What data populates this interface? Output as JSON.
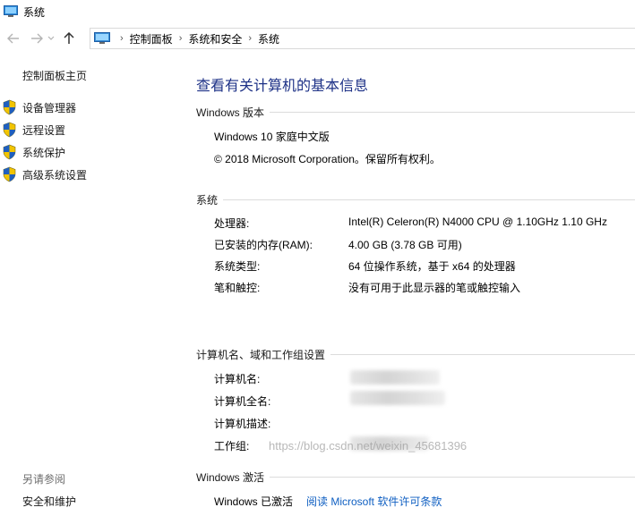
{
  "window": {
    "title": "系统"
  },
  "breadcrumb": {
    "items": [
      "控制面板",
      "系统和安全",
      "系统"
    ]
  },
  "sidebar": {
    "home": "控制面板主页",
    "links": [
      "设备管理器",
      "远程设置",
      "系统保护",
      "高级系统设置"
    ],
    "see_also": "另请参阅",
    "security": "安全和维护"
  },
  "main": {
    "title": "查看有关计算机的基本信息",
    "edition": {
      "heading": "Windows 版本",
      "name": "Windows 10 家庭中文版",
      "copyright": "© 2018 Microsoft Corporation。保留所有权利。"
    },
    "system": {
      "heading": "系统",
      "rows": [
        {
          "label": "处理器:",
          "value": "Intel(R) Celeron(R) N4000 CPU @ 1.10GHz   1.10 GHz"
        },
        {
          "label": "已安装的内存(RAM):",
          "value": "4.00 GB (3.78 GB 可用)"
        },
        {
          "label": "系统类型:",
          "value": "64 位操作系统，基于 x64 的处理器"
        },
        {
          "label": "笔和触控:",
          "value": "没有可用于此显示器的笔或触控输入"
        }
      ]
    },
    "computer": {
      "heading": "计算机名、域和工作组设置",
      "labels": [
        "计算机名:",
        "计算机全名:",
        "计算机描述:",
        "工作组:"
      ]
    },
    "activation": {
      "heading": "Windows 激活",
      "status": "Windows 已激活",
      "link": "阅读 Microsoft 软件许可条款"
    }
  },
  "watermark": "https://blog.csdn.net/weixin_45681396",
  "colors": {
    "title_blue": "#1e3287",
    "link_blue": "#0f5fc2",
    "shield_blue": "#1f5fbf",
    "shield_yellow": "#f2c400"
  }
}
